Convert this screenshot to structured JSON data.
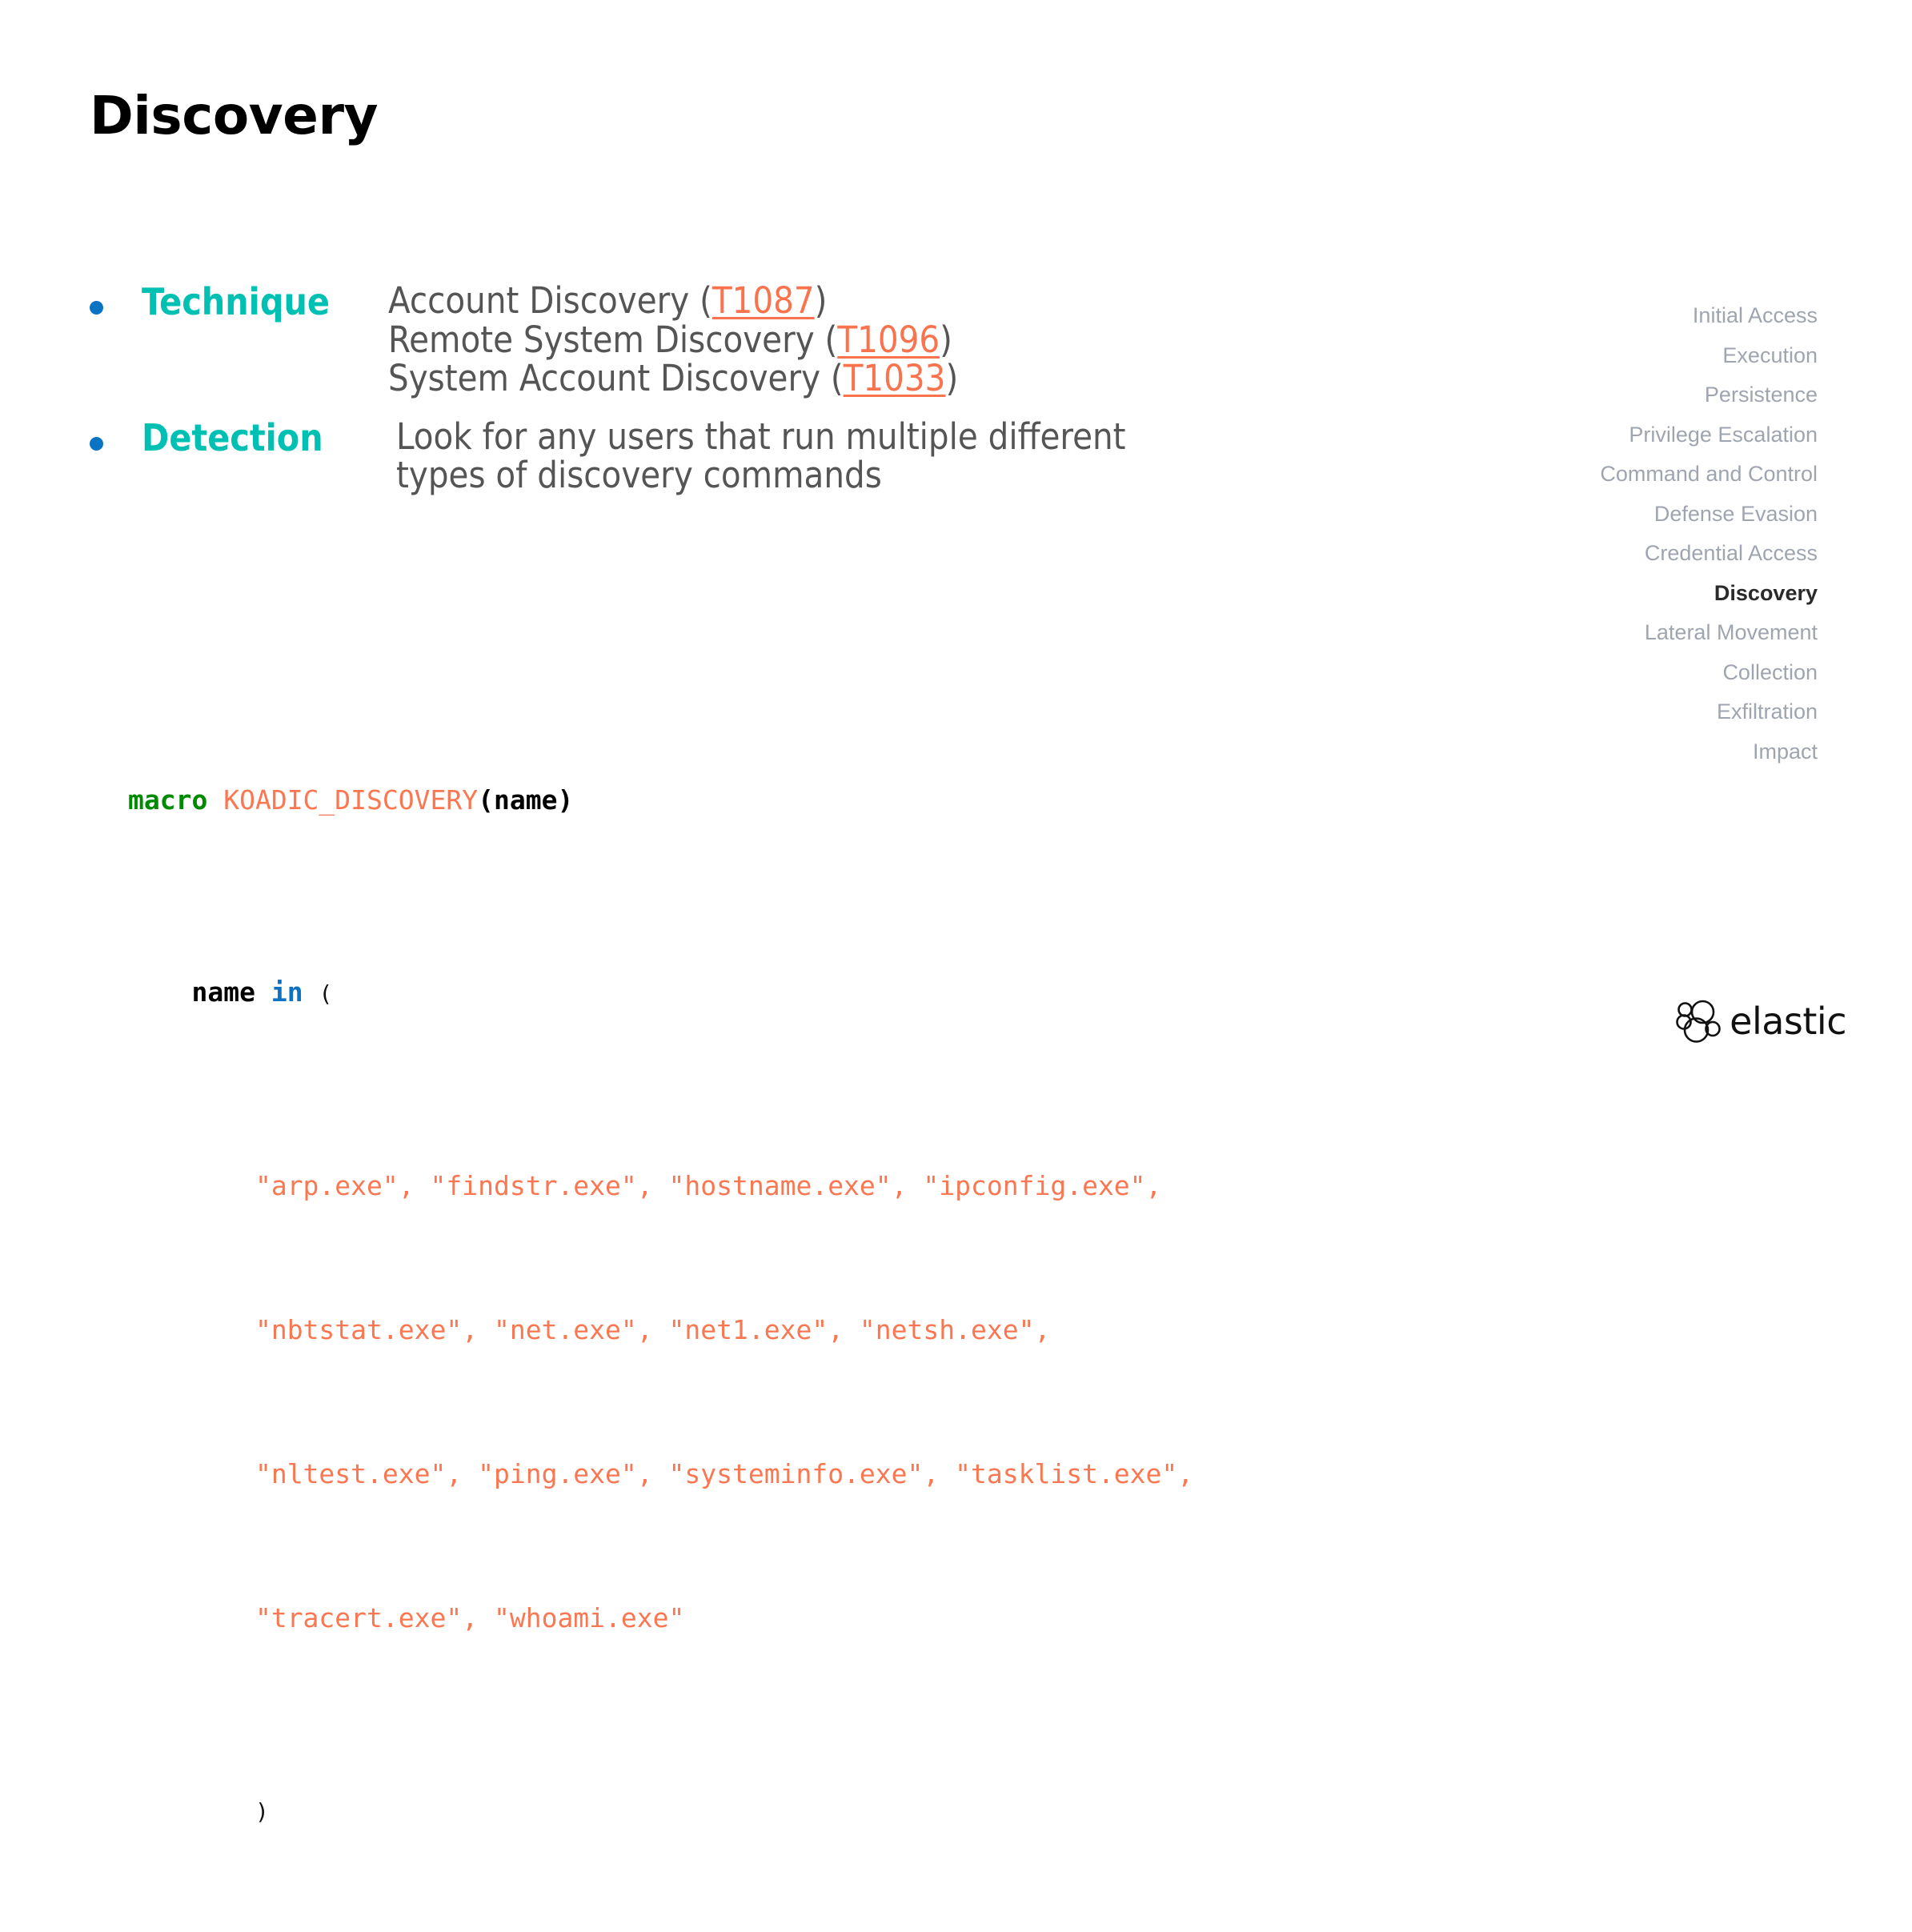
{
  "slide": {
    "title": "Discovery"
  },
  "bullets": [
    {
      "label": "Technique",
      "lines": [
        {
          "prefix": "Account Discovery (",
          "code": "T1087",
          "suffix": ")"
        },
        {
          "prefix": "Remote System Discovery (",
          "code": "T1096",
          "suffix": ")"
        },
        {
          "prefix": "System Account Discovery (",
          "code": "T1033",
          "suffix": ")"
        }
      ]
    },
    {
      "label": "Detection",
      "text_line_1": "Look for any users that run multiple different",
      "text_line_2": "types of discovery commands"
    }
  ],
  "code": {
    "line1": {
      "keyword": "macro",
      "space": " ",
      "name": "KOADIC_DISCOVERY",
      "open_paren": "(",
      "param": "name",
      "close_paren": ")"
    },
    "line2": {
      "indent": "    ",
      "variable": "name",
      "space": " ",
      "keyword": "in",
      "space2": " ",
      "open_paren": "("
    },
    "string_lines": [
      "\"arp.exe\", \"findstr.exe\", \"hostname.exe\", \"ipconfig.exe\",",
      "\"nbtstat.exe\", \"net.exe\", \"net1.exe\", \"netsh.exe\",",
      "\"nltest.exe\", \"ping.exe\", \"systeminfo.exe\", \"tasklist.exe\",",
      "\"tracert.exe\", \"whoami.exe\""
    ],
    "closing_paren": ")"
  },
  "tactics": {
    "items": [
      {
        "label": "Initial Access",
        "active": false
      },
      {
        "label": "Execution",
        "active": false
      },
      {
        "label": "Persistence",
        "active": false
      },
      {
        "label": "Privilege Escalation",
        "active": false
      },
      {
        "label": "Command and Control",
        "active": false
      },
      {
        "label": "Defense Evasion",
        "active": false
      },
      {
        "label": "Credential Access",
        "active": false
      },
      {
        "label": "Discovery",
        "active": true
      },
      {
        "label": "Lateral Movement",
        "active": false
      },
      {
        "label": "Collection",
        "active": false
      },
      {
        "label": "Exfiltration",
        "active": false
      },
      {
        "label": "Impact",
        "active": false
      }
    ]
  },
  "brand": {
    "name": "elastic",
    "logo_icon": "elastic-cluster-logo"
  },
  "colors": {
    "accent_teal": "#00bfb3",
    "bullet_blue": "#0b73c4",
    "link_orange": "#f9734e",
    "body_gray": "#555555",
    "tactic_gray": "#9fa5b0",
    "tactic_active": "#2a2a2a",
    "code_green": "#008a00",
    "code_blue": "#0b73c4",
    "code_orange": "#fa7751"
  }
}
